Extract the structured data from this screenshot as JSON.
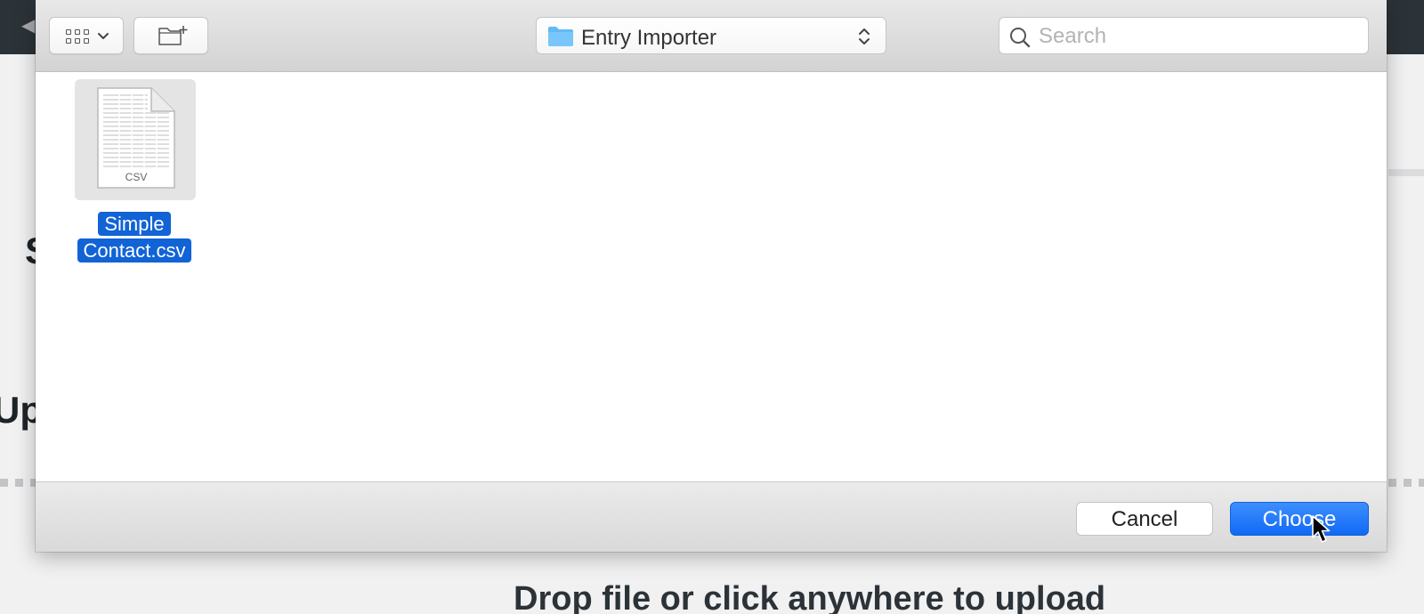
{
  "background_page": {
    "heading_fragment_1": "S",
    "heading_fragment_2": "Upl",
    "drop_text": "Drop file or click anywhere to upload"
  },
  "dialog": {
    "toolbar": {
      "view_button_icon": "icon-view-grid-icon",
      "new_folder_icon": "folder-plus-icon",
      "location": "Entry Importer",
      "search": {
        "placeholder": "Search",
        "value": ""
      }
    },
    "files": [
      {
        "name_line_1": "Simple",
        "name_line_2": "Contact.csv",
        "type_label": "CSV",
        "selected": true
      }
    ],
    "buttons": {
      "cancel": "Cancel",
      "choose": "Choose"
    }
  },
  "colors": {
    "selection": "#1163d6",
    "primary_button": "#1a73f8",
    "folder": "#5ab4f5"
  }
}
